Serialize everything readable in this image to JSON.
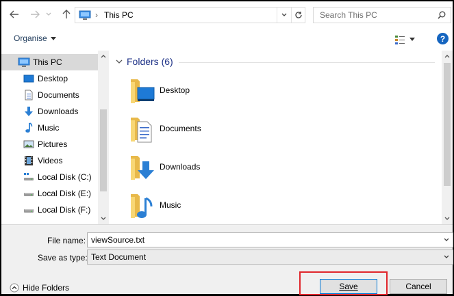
{
  "address_bar": {
    "location_icon": "computer-icon",
    "path": [
      "This PC"
    ],
    "separator": "›",
    "search_placeholder": "Search This PC"
  },
  "toolbar": {
    "organise_label": "Organise"
  },
  "nav_pane": {
    "items": [
      {
        "label": "This PC",
        "icon": "computer-icon",
        "selected": true
      },
      {
        "label": "Desktop",
        "icon": "desktop-icon"
      },
      {
        "label": "Documents",
        "icon": "documents-icon"
      },
      {
        "label": "Downloads",
        "icon": "download-arrow-icon"
      },
      {
        "label": "Music",
        "icon": "music-note-icon"
      },
      {
        "label": "Pictures",
        "icon": "pictures-icon"
      },
      {
        "label": "Videos",
        "icon": "videos-icon"
      },
      {
        "label": "Local Disk (C:)",
        "icon": "system-drive-icon"
      },
      {
        "label": "Local Disk (E:)",
        "icon": "drive-icon"
      },
      {
        "label": "Local Disk (F:)",
        "icon": "drive-icon"
      }
    ]
  },
  "content": {
    "group_title": "Folders (6)",
    "folders": [
      {
        "name": "Desktop",
        "overlay": "desktop-icon"
      },
      {
        "name": "Documents",
        "overlay": "documents-icon"
      },
      {
        "name": "Downloads",
        "overlay": "download-arrow-icon"
      },
      {
        "name": "Music",
        "overlay": "music-note-icon"
      }
    ]
  },
  "save_form": {
    "file_name_label": "File name:",
    "file_name_value": "viewSource.txt",
    "save_type_label": "Save as type:",
    "save_type_value": "Text Document",
    "hide_folders_label": "Hide Folders",
    "save_label": "Save",
    "cancel_label": "Cancel"
  },
  "colors": {
    "accent_blue": "#1e3287",
    "folder_yellow": "#f8d775",
    "icon_blue": "#2b7fd4",
    "highlight_red": "#e0252b",
    "help_blue": "#1565c0"
  }
}
